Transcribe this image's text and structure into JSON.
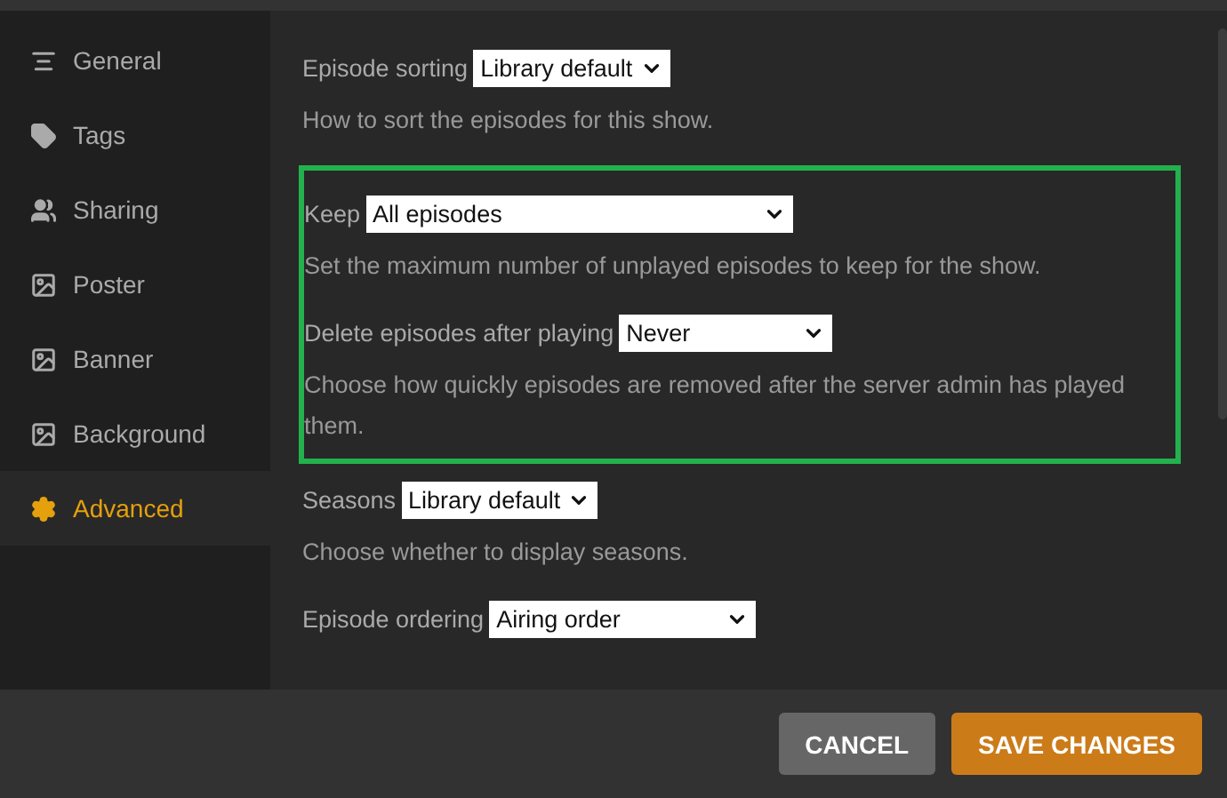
{
  "sidebar": {
    "items": [
      {
        "label": "General",
        "selected": false
      },
      {
        "label": "Tags",
        "selected": false
      },
      {
        "label": "Sharing",
        "selected": false
      },
      {
        "label": "Poster",
        "selected": false
      },
      {
        "label": "Banner",
        "selected": false
      },
      {
        "label": "Background",
        "selected": false
      },
      {
        "label": "Advanced",
        "selected": true
      }
    ]
  },
  "sections": [
    {
      "highlighted": false,
      "settings": [
        {
          "label": "Episode sorting",
          "value": "Library default",
          "description": "How to sort the episodes for this show."
        }
      ]
    },
    {
      "highlighted": true,
      "settings": [
        {
          "label": "Keep",
          "value": "All episodes",
          "description": "Set the maximum number of unplayed episodes to keep for the show."
        },
        {
          "label": "Delete episodes after playing",
          "value": "Never",
          "description": "Choose how quickly episodes are removed after the server admin has played them."
        }
      ]
    },
    {
      "highlighted": false,
      "settings": [
        {
          "label": "Seasons",
          "value": "Library default",
          "description": "Choose whether to display seasons."
        },
        {
          "label": "Episode ordering",
          "value": "Airing order"
        }
      ]
    }
  ],
  "buttons": [
    {
      "label": "CANCEL",
      "kind": "secondary"
    },
    {
      "label": "SAVE CHANGES",
      "kind": "primary"
    }
  ]
}
